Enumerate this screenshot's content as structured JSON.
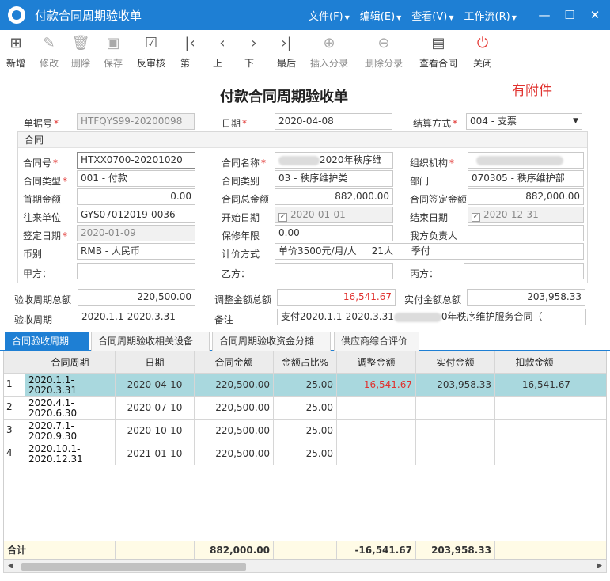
{
  "window": {
    "title": "付款合同周期验收单",
    "menus": [
      "文件(F)",
      "编辑(E)",
      "查看(V)",
      "工作流(R)"
    ],
    "controls": [
      "minimize",
      "maximize",
      "close"
    ]
  },
  "toolbar": [
    {
      "name": "new",
      "label": "新增",
      "icon": "new-doc-icon",
      "glyph": "⊞",
      "enabled": true
    },
    {
      "name": "edit",
      "label": "修改",
      "icon": "edit-icon",
      "glyph": "✎",
      "enabled": false
    },
    {
      "name": "delete",
      "label": "删除",
      "icon": "trash-icon",
      "glyph": "🗑",
      "enabled": false
    },
    {
      "name": "save",
      "label": "保存",
      "icon": "save-icon",
      "glyph": "▣",
      "enabled": false
    },
    {
      "name": "unaudit",
      "label": "反审核",
      "icon": "unaudit-icon",
      "glyph": "☑",
      "enabled": true
    },
    {
      "name": "first",
      "label": "第一",
      "icon": "first-icon",
      "glyph": "|‹",
      "enabled": true
    },
    {
      "name": "prev",
      "label": "上一",
      "icon": "prev-icon",
      "glyph": "‹",
      "enabled": true
    },
    {
      "name": "next",
      "label": "下一",
      "icon": "next-icon",
      "glyph": "›",
      "enabled": true
    },
    {
      "name": "last",
      "label": "最后",
      "icon": "last-icon",
      "glyph": "›|",
      "enabled": true
    },
    {
      "name": "insert-entry",
      "label": "插入分录",
      "icon": "plus-circle-icon",
      "glyph": "⊕",
      "enabled": false
    },
    {
      "name": "delete-entry",
      "label": "删除分录",
      "icon": "minus-circle-icon",
      "glyph": "⊖",
      "enabled": false
    },
    {
      "name": "view-contract",
      "label": "查看合同",
      "icon": "document-icon",
      "glyph": "▤",
      "enabled": true
    },
    {
      "name": "close",
      "label": "关闭",
      "icon": "power-icon",
      "glyph": "⏻",
      "enabled": true
    }
  ],
  "form": {
    "title": "付款合同周期验收单",
    "attachment_note": "有附件",
    "header": {
      "bill_no": {
        "label": "单据号",
        "value": "HTFQYS99-20200098"
      },
      "date": {
        "label": "日期",
        "value": "2020-04-08"
      },
      "settle": {
        "label": "结算方式",
        "value": "004 - 支票"
      }
    },
    "contract_group": "合同",
    "contract": {
      "no": {
        "label": "合同号",
        "value": "HTXX0700-20201020"
      },
      "name": {
        "label": "合同名称",
        "value": "2020年秩序维"
      },
      "org": {
        "label": "组织机构",
        "value": ""
      },
      "type": {
        "label": "合同类型",
        "value": "001 - 付款"
      },
      "category": {
        "label": "合同类别",
        "value": "03 - 秩序维护类"
      },
      "dept": {
        "label": "部门",
        "value": "070305 - 秩序维护部"
      },
      "first_amount": {
        "label": "首期金额",
        "value": "0.00"
      },
      "total_amount": {
        "label": "合同总金额",
        "value": "882,000.00"
      },
      "fixed_amount": {
        "label": "合同签定金额",
        "value": "882,000.00"
      },
      "partner": {
        "label": "往来单位",
        "value": "GYS07012019-0036 -"
      },
      "start": {
        "label": "开始日期",
        "value": "2020-01-01"
      },
      "end": {
        "label": "结束日期",
        "value": "2020-12-31"
      },
      "sign_date": {
        "label": "签定日期",
        "value": "2020-01-09"
      },
      "warranty": {
        "label": "保修年限",
        "value": "0.00"
      },
      "owner": {
        "label": "我方负责人",
        "value": ""
      },
      "currency": {
        "label": "币别",
        "value": "RMB - 人民币"
      },
      "pricing": {
        "label": "计价方式",
        "value": "单价3500元/月/人     21人      季付"
      },
      "party_a": {
        "label": "甲方：",
        "value": ""
      },
      "party_b": {
        "label": "乙方：",
        "value": ""
      },
      "party_c": {
        "label": "丙方：",
        "value": ""
      }
    },
    "summary": {
      "period_total": {
        "label": "验收周期总额",
        "value": "220,500.00"
      },
      "adjust_total": {
        "label": "调整金额总额",
        "value": "16,541.67"
      },
      "actual_total": {
        "label": "实付金额总额",
        "value": "203,958.33"
      },
      "period": {
        "label": "验收周期",
        "value": "2020.1.1-2020.3.31"
      },
      "remark": {
        "label": "备注",
        "value_pre": "支付2020.1.1-2020.3.31",
        "value_post": "0年秩序维护服务合同（"
      }
    }
  },
  "tabs": [
    "合同验收周期",
    "合同周期验收相关设备",
    "合同周期验收资金分摊",
    "供应商综合评价"
  ],
  "grid": {
    "columns": [
      "",
      "合同周期",
      "日期",
      "合同金额",
      "金额占比%",
      "调整金额",
      "实付金额",
      "扣款金额"
    ],
    "rows": [
      {
        "no": "1",
        "period": "2020.1.1-",
        "period2": "2020.3.31",
        "date": "2020-04-10",
        "amount": "220,500.00",
        "ratio": "25.00",
        "adjust": "-16,541.67",
        "actual": "203,958.33",
        "deduct": "16,541.67"
      },
      {
        "no": "2",
        "period": "2020.4.1-",
        "period2": "2020.6.30",
        "date": "2020-07-10",
        "amount": "220,500.00",
        "ratio": "25.00",
        "adjust": "",
        "actual": "",
        "deduct": ""
      },
      {
        "no": "3",
        "period": "2020.7.1-",
        "period2": "2020.9.30",
        "date": "2020-10-10",
        "amount": "220,500.00",
        "ratio": "25.00",
        "adjust": "",
        "actual": "",
        "deduct": ""
      },
      {
        "no": "4",
        "period": "2020.10.1-",
        "period2": "2020.12.31",
        "date": "2021-01-10",
        "amount": "220,500.00",
        "ratio": "25.00",
        "adjust": "",
        "actual": "",
        "deduct": ""
      }
    ],
    "total": {
      "label": "合计",
      "amount": "882,000.00",
      "adjust": "-16,541.67",
      "actual": "203,958.33"
    }
  },
  "colors": {
    "primary": "#1e7fd4",
    "selected_row": "#a9d8de",
    "required": "#e0312e"
  }
}
